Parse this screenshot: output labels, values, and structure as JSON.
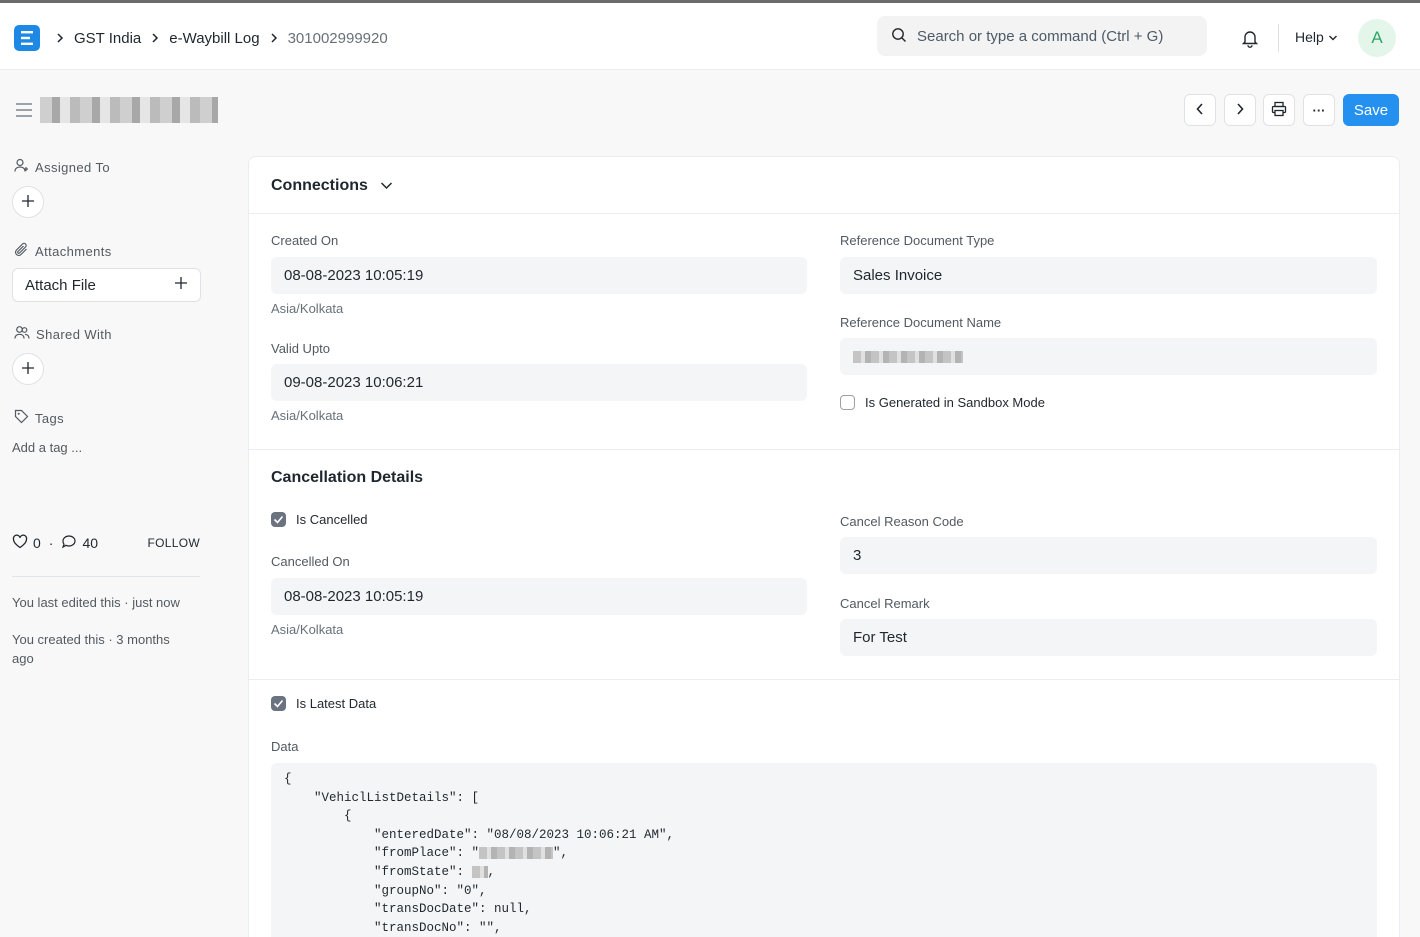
{
  "navbar": {
    "logo_letter": "E",
    "breadcrumbs": [
      "GST India",
      "e-Waybill Log",
      "301002999920"
    ],
    "search_placeholder": "Search or type a command (Ctrl + G)",
    "help_label": "Help",
    "avatar_initial": "A"
  },
  "toolbar": {
    "save_label": "Save",
    "more_label": "···"
  },
  "sidebar": {
    "assigned_to": "Assigned To",
    "attachments": "Attachments",
    "attach_file": "Attach File",
    "shared_with": "Shared With",
    "tags": "Tags",
    "add_tag": "Add a tag ...",
    "likes": "0",
    "comments": "40",
    "dot": "·",
    "follow": "FOLLOW",
    "edited": "You last edited this · just now",
    "created": "You created this · 3 months ago"
  },
  "connections": {
    "title": "Connections",
    "created_on_label": "Created On",
    "created_on": "08-08-2023 10:05:19",
    "created_tz": "Asia/Kolkata",
    "valid_upto_label": "Valid Upto",
    "valid_upto": "09-08-2023 10:06:21",
    "valid_tz": "Asia/Kolkata",
    "ref_type_label": "Reference Document Type",
    "ref_type": "Sales Invoice",
    "ref_name_label": "Reference Document Name",
    "sandbox_label": "Is Generated in Sandbox Mode"
  },
  "cancellation": {
    "title": "Cancellation Details",
    "is_cancelled_label": "Is Cancelled",
    "cancelled_on_label": "Cancelled On",
    "cancelled_on": "08-08-2023 10:05:19",
    "cancelled_tz": "Asia/Kolkata",
    "reason_code_label": "Cancel Reason Code",
    "reason_code": "3",
    "remark_label": "Cancel Remark",
    "remark": "For Test"
  },
  "data_section": {
    "is_latest_label": "Is Latest Data",
    "data_label": "Data",
    "lines": [
      "{",
      "    \"VehiclListDetails\": [",
      "        {",
      "            \"enteredDate\": \"08/08/2023 10:06:21 AM\",",
      "            \"fromPlace\": \"",
      "            \"fromState\": ",
      "            \"groupNo\": \"0\",",
      "            \"transDocDate\": null,",
      "            \"transDocNo\": \"\","
    ],
    "line_suffix_place": "\",",
    "line_suffix_state": ","
  }
}
